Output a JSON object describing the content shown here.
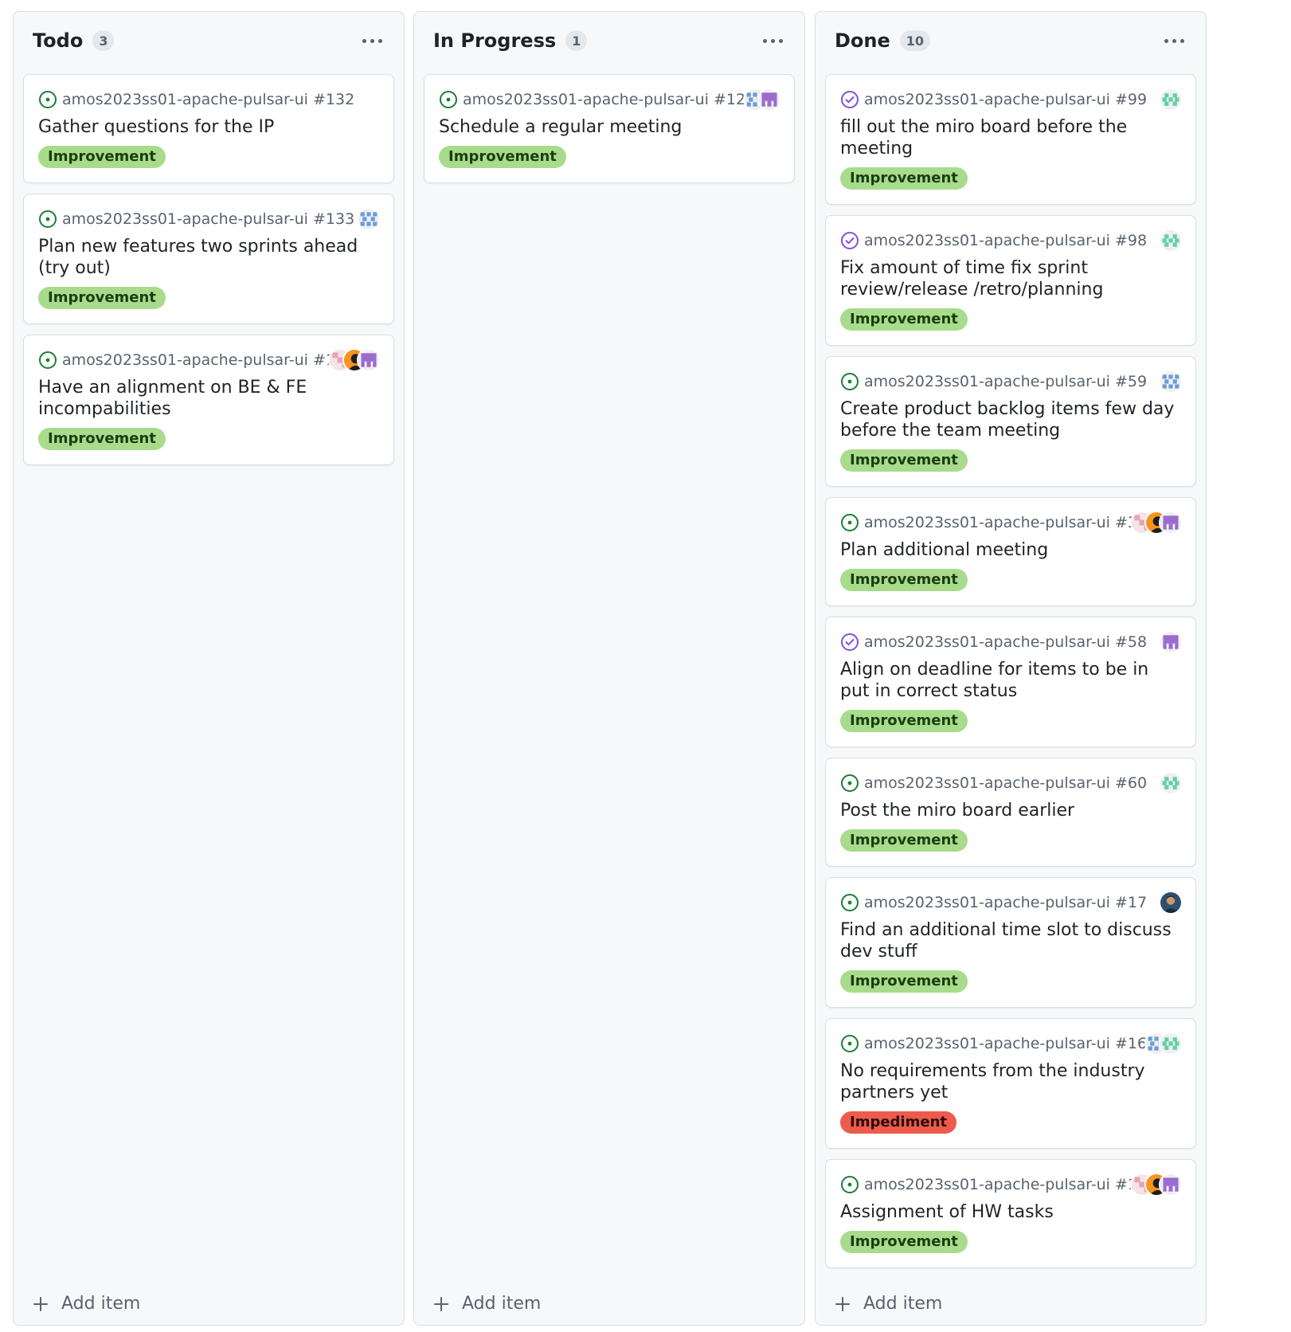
{
  "columns": [
    {
      "title": "Todo",
      "count": "3",
      "add_item": "Add item",
      "cards": [
        {
          "repo": "amos2023ss01-apache-pulsar-ui #132",
          "title": "Gather questions for the IP",
          "label": "Improvement",
          "label_kind": "improvement",
          "status": "open",
          "avatars": []
        },
        {
          "repo": "amos2023ss01-apache-pulsar-ui #133",
          "title": "Plan new features two sprints ahead (try out)",
          "label": "Improvement",
          "label_kind": "improvement",
          "status": "open",
          "avatars": [
            "blue-identicon"
          ]
        },
        {
          "repo": "amos2023ss01-apache-pulsar-ui #134",
          "title": "Have an alignment on BE & FE incompabilities",
          "label": "Improvement",
          "label_kind": "improvement",
          "status": "open",
          "avatars": [
            "pink-identicon",
            "orange-avatar",
            "purple-identicon"
          ]
        }
      ]
    },
    {
      "title": "In Progress",
      "count": "1",
      "add_item": "Add item",
      "cards": [
        {
          "repo": "amos2023ss01-apache-pulsar-ui #121",
          "title": "Schedule a regular meeting",
          "label": "Improvement",
          "label_kind": "improvement",
          "status": "open",
          "avatars": [
            "blue-identicon",
            "purple-identicon"
          ]
        }
      ]
    },
    {
      "title": "Done",
      "count": "10",
      "add_item": "Add item",
      "cards": [
        {
          "repo": "amos2023ss01-apache-pulsar-ui #99",
          "title": "fill out the miro board before the meeting",
          "label": "Improvement",
          "label_kind": "improvement",
          "status": "closed",
          "avatars": [
            "green-identicon"
          ]
        },
        {
          "repo": "amos2023ss01-apache-pulsar-ui #98",
          "title": "Fix amount of time fix sprint review/release /retro/planning",
          "label": "Improvement",
          "label_kind": "improvement",
          "status": "closed",
          "avatars": [
            "green-identicon"
          ]
        },
        {
          "repo": "amos2023ss01-apache-pulsar-ui #59",
          "title": "Create product backlog items few day before the team meeting",
          "label": "Improvement",
          "label_kind": "improvement",
          "status": "open",
          "avatars": [
            "blue-identicon"
          ]
        },
        {
          "repo": "amos2023ss01-apache-pulsar-ui #33",
          "title": "Plan additional meeting",
          "label": "Improvement",
          "label_kind": "improvement",
          "status": "open",
          "avatars": [
            "pink-identicon",
            "orange-avatar",
            "purple-identicon"
          ]
        },
        {
          "repo": "amos2023ss01-apache-pulsar-ui #58",
          "title": "Align on deadline for items to be in put in correct status",
          "label": "Improvement",
          "label_kind": "improvement",
          "status": "closed",
          "avatars": [
            "purple-identicon"
          ]
        },
        {
          "repo": "amos2023ss01-apache-pulsar-ui #60",
          "title": "Post the miro board earlier",
          "label": "Improvement",
          "label_kind": "improvement",
          "status": "open",
          "avatars": [
            "green-identicon"
          ]
        },
        {
          "repo": "amos2023ss01-apache-pulsar-ui #17",
          "title": "Find an additional time slot to discuss dev stuff",
          "label": "Improvement",
          "label_kind": "improvement",
          "status": "open",
          "avatars": [
            "photo-avatar"
          ]
        },
        {
          "repo": "amos2023ss01-apache-pulsar-ui #16",
          "title": "No requirements from the industry partners yet",
          "label": "Impediment",
          "label_kind": "impediment",
          "status": "open",
          "avatars": [
            "blue-identicon",
            "green-identicon"
          ]
        },
        {
          "repo": "amos2023ss01-apache-pulsar-ui #18",
          "title": "Assignment of HW tasks",
          "label": "Improvement",
          "label_kind": "improvement",
          "status": "open",
          "avatars": [
            "pink-identicon",
            "orange-avatar",
            "purple-identicon"
          ]
        }
      ]
    }
  ],
  "colors": {
    "open_status": "#1a7f37",
    "closed_status": "#8250df",
    "improvement_label": "#a8dc8c",
    "impediment_label": "#ec5b4b"
  }
}
